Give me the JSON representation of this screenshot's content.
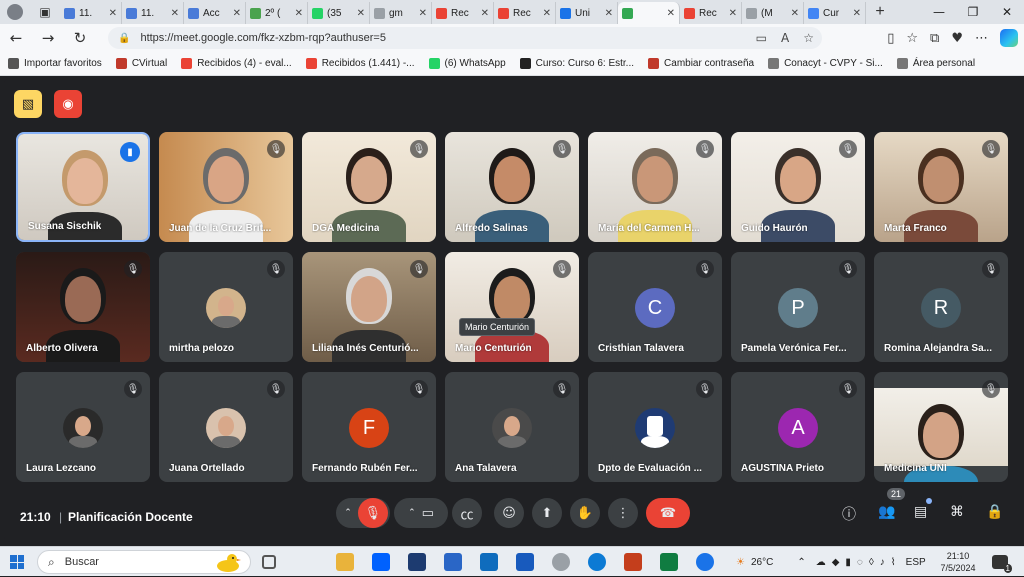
{
  "browser": {
    "tabs": [
      {
        "label": "11.",
        "favicon_color": "#4a7bd8"
      },
      {
        "label": "11.",
        "favicon_color": "#4a7bd8"
      },
      {
        "label": "Acc",
        "favicon_color": "#4a7bd8"
      },
      {
        "label": "2º (",
        "favicon_color": "#4aa34e"
      },
      {
        "label": "(35",
        "favicon_color": "#25d366"
      },
      {
        "label": "gm",
        "favicon_color": "#9aa0a6"
      },
      {
        "label": "Rec",
        "favicon_color": "#ea4335"
      },
      {
        "label": "Rec",
        "favicon_color": "#ea4335"
      },
      {
        "label": "Uni",
        "favicon_color": "#1a73e8"
      },
      {
        "label": "",
        "favicon_color": "#34a853"
      },
      {
        "label": "Rec",
        "favicon_color": "#ea4335"
      },
      {
        "label": "(M",
        "favicon_color": "#9aa0a6"
      },
      {
        "label": "Cur",
        "favicon_color": "#4285f4"
      }
    ],
    "url": "https://meet.google.com/fkz-xzbm-rqp?authuser=5",
    "bookmarks": [
      {
        "label": "Importar favoritos",
        "color": "#555"
      },
      {
        "label": "CVirtual",
        "color": "#c0392b"
      },
      {
        "label": "Recibidos (4) - eval...",
        "color": "#ea4335"
      },
      {
        "label": "Recibidos (1.441) -...",
        "color": "#ea4335"
      },
      {
        "label": "(6) WhatsApp",
        "color": "#25d366"
      },
      {
        "label": "Curso: Curso 6: Estr...",
        "color": "#222"
      },
      {
        "label": "Cambiar contraseña",
        "color": "#c0392b"
      },
      {
        "label": "Conacyt - CVPY - Si...",
        "color": "#777"
      },
      {
        "label": "Área personal",
        "color": "#777"
      }
    ]
  },
  "participants": [
    {
      "name": "Susana Sischik",
      "kind": "video",
      "speaking": true
    },
    {
      "name": "Juan de la Cruz Brit...",
      "kind": "video"
    },
    {
      "name": "DGA Medicina",
      "kind": "video"
    },
    {
      "name": "Alfredo Salinas",
      "kind": "video"
    },
    {
      "name": "María del Carmen H...",
      "kind": "video"
    },
    {
      "name": "Guido Haurón",
      "kind": "video"
    },
    {
      "name": "Marta Franco",
      "kind": "video"
    },
    {
      "name": "Alberto Olivera",
      "kind": "video"
    },
    {
      "name": "mirtha pelozo",
      "kind": "photo"
    },
    {
      "name": "Liliana Inés Centurió...",
      "kind": "video"
    },
    {
      "name": "Mario Centurión",
      "kind": "video",
      "tooltip": "Mario Centurión"
    },
    {
      "name": "Cristhian Talavera",
      "kind": "letter",
      "letter": "C",
      "color": "#5c6bc0"
    },
    {
      "name": "Pamela Verónica Fer...",
      "kind": "letter",
      "letter": "P",
      "color": "#607d8b"
    },
    {
      "name": "Romina Alejandra Sa...",
      "kind": "letter",
      "letter": "R",
      "color": "#455a64"
    },
    {
      "name": "Laura Lezcano",
      "kind": "photo"
    },
    {
      "name": "Juana Ortellado",
      "kind": "photo"
    },
    {
      "name": "Fernando Rubén Fer...",
      "kind": "letter",
      "letter": "F",
      "color": "#d84315"
    },
    {
      "name": "Ana Talavera",
      "kind": "photo"
    },
    {
      "name": "Dpto de Evaluación ...",
      "kind": "photo"
    },
    {
      "name": "AGUSTINA Prieto",
      "kind": "letter",
      "letter": "A",
      "color": "#9c27b0"
    },
    {
      "name": "Medicina UNI",
      "kind": "video"
    }
  ],
  "meeting": {
    "time": "21:10",
    "title": "Planificación Docente",
    "participant_count": "21"
  },
  "taskbar": {
    "search_placeholder": "Buscar",
    "weather": "26°C",
    "language": "ESP",
    "time": "21:10",
    "date": "7/5/2024",
    "notification_count": "1"
  },
  "colors": {
    "meet_bg": "#202124",
    "tile_bg": "#3c4043",
    "end_call": "#ea4335",
    "speaking_border": "#8ab4f8"
  }
}
